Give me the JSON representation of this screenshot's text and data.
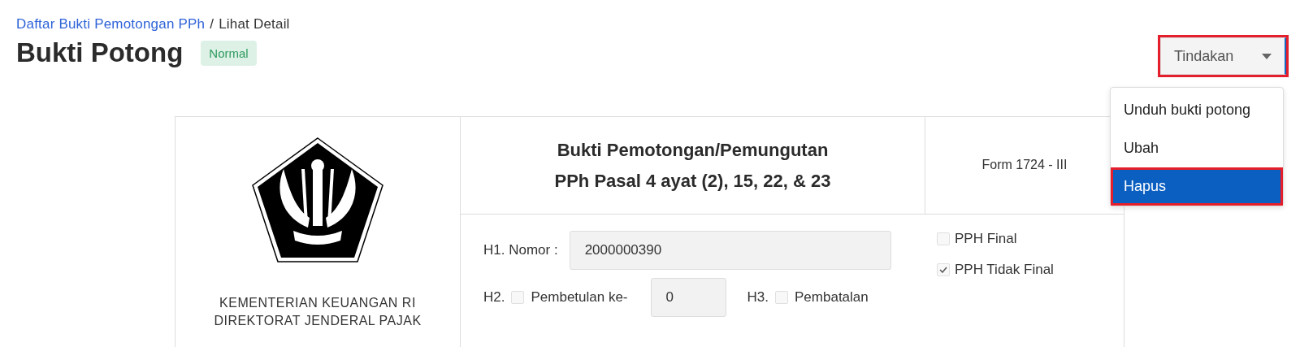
{
  "breadcrumb": {
    "link": "Daftar Bukti Pemotongan PPh",
    "separator": "/",
    "current": "Lihat Detail"
  },
  "title": "Bukti Potong",
  "status_badge": "Normal",
  "actions": {
    "label": "Tindakan",
    "highlighted": true,
    "expanded": true,
    "menu": [
      {
        "label": "Unduh bukti potong",
        "selected": false,
        "highlighted": false
      },
      {
        "label": "Ubah",
        "selected": false,
        "highlighted": false
      },
      {
        "label": "Hapus",
        "selected": true,
        "highlighted": true
      }
    ]
  },
  "form": {
    "agency_lines": [
      "KEMENTERIAN KEUANGAN RI",
      "DIREKTORAT JENDERAL PAJAK"
    ],
    "heading_lines": [
      "Bukti Pemotongan/Pemungutan",
      "PPh Pasal 4 ayat (2), 15, 22, & 23"
    ],
    "form_code": "Form 1724 - III",
    "h1": {
      "label": "H1. Nomor :",
      "value": "2000000390"
    },
    "h2": {
      "label": "H2.",
      "checkbox_label": "Pembetulan ke-",
      "checked": false,
      "value": "0"
    },
    "h3": {
      "label": "H3.",
      "checkbox_label": "Pembatalan",
      "checked": false
    },
    "pph_types": [
      {
        "label": "PPH Final",
        "checked": false
      },
      {
        "label": "PPH Tidak Final",
        "checked": true
      }
    ]
  }
}
